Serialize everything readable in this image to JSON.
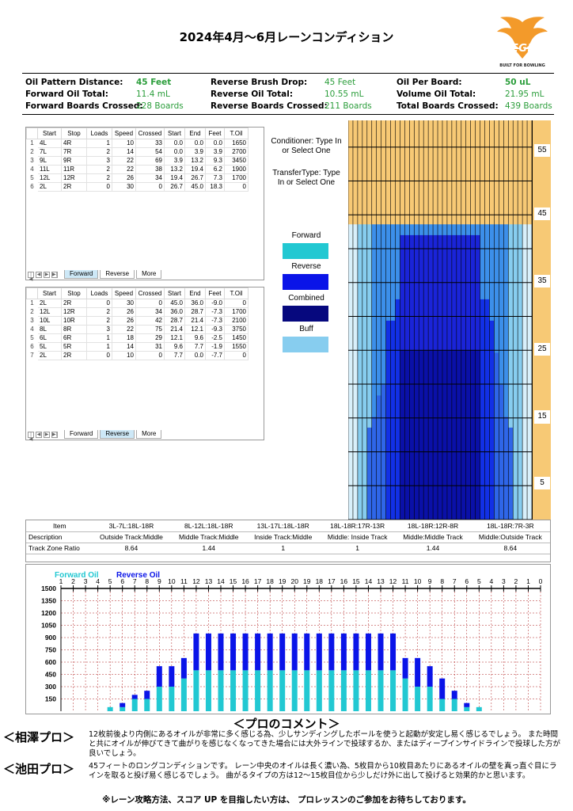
{
  "title": "2024年4月～6月レーンコンディション",
  "logo": {
    "name": "KEGEL",
    "tagline": "BUILT FOR BOWLING",
    "color": "#f39a2a"
  },
  "info": [
    {
      "label": "Oil Pattern Distance:",
      "value": "45 Feet"
    },
    {
      "label": "Reverse Brush Drop:",
      "value": "45 Feet"
    },
    {
      "label": "Oil Per Board:",
      "value": "50 uL"
    },
    {
      "label": "Forward Oil Total:",
      "value": "11.4 mL"
    },
    {
      "label": "Reverse Oil Total:",
      "value": "10.55 mL"
    },
    {
      "label": "Volume Oil Total:",
      "value": "21.95 mL"
    },
    {
      "label": "Forward Boards Crossed:",
      "value": "228 Boards"
    },
    {
      "label": "Reverse Boards Crossed:",
      "value": "211 Boards"
    },
    {
      "label": "Total Boards Crossed:",
      "value": "439 Boards"
    }
  ],
  "table_headers": [
    "Start",
    "Stop",
    "Loads",
    "Speed",
    "Crossed",
    "Start",
    "End",
    "Feet",
    "T.Oil"
  ],
  "forward_rows": [
    [
      "1",
      "4L",
      "4R",
      "1",
      "10",
      "33",
      "0.0",
      "0.0",
      "0.0",
      "1650"
    ],
    [
      "2",
      "7L",
      "7R",
      "2",
      "14",
      "54",
      "0.0",
      "3.9",
      "3.9",
      "2700"
    ],
    [
      "3",
      "9L",
      "9R",
      "3",
      "22",
      "69",
      "3.9",
      "13.2",
      "9.3",
      "3450"
    ],
    [
      "4",
      "11L",
      "11R",
      "2",
      "22",
      "38",
      "13.2",
      "19.4",
      "6.2",
      "1900"
    ],
    [
      "5",
      "12L",
      "12R",
      "2",
      "26",
      "34",
      "19.4",
      "26.7",
      "7.3",
      "1700"
    ],
    [
      "6",
      "2L",
      "2R",
      "0",
      "30",
      "0",
      "26.7",
      "45.0",
      "18.3",
      "0"
    ]
  ],
  "reverse_rows": [
    [
      "1",
      "2L",
      "2R",
      "0",
      "30",
      "0",
      "45.0",
      "36.0",
      "-9.0",
      "0"
    ],
    [
      "2",
      "12L",
      "12R",
      "2",
      "26",
      "34",
      "36.0",
      "28.7",
      "-7.3",
      "1700"
    ],
    [
      "3",
      "10L",
      "10R",
      "2",
      "26",
      "42",
      "28.7",
      "21.4",
      "-7.3",
      "2100"
    ],
    [
      "4",
      "8L",
      "8R",
      "3",
      "22",
      "75",
      "21.4",
      "12.1",
      "-9.3",
      "3750"
    ],
    [
      "5",
      "6L",
      "6R",
      "1",
      "18",
      "29",
      "12.1",
      "9.6",
      "-2.5",
      "1450"
    ],
    [
      "6",
      "5L",
      "5R",
      "1",
      "14",
      "31",
      "9.6",
      "7.7",
      "-1.9",
      "1550"
    ],
    [
      "7",
      "2L",
      "2R",
      "0",
      "10",
      "0",
      "7.7",
      "0.0",
      "-7.7",
      "0"
    ]
  ],
  "tabs_top": {
    "nav": [
      "|◀",
      "◀",
      "▶",
      "▶|"
    ],
    "items": [
      "Forward",
      "Reverse",
      "More"
    ],
    "active": 0
  },
  "tabs_bottom": {
    "nav": [
      "|◀",
      "◀",
      "▶",
      "▶|"
    ],
    "items": [
      "Forward",
      "Reverse",
      "More"
    ],
    "active": 1
  },
  "conditioner": "Conditioner: Type In or Select One",
  "transfer": "TransferType: Type In or Select One",
  "legend": [
    {
      "label": "Forward",
      "color": "#22c8d2"
    },
    {
      "label": "Reverse",
      "color": "#0a14e8"
    },
    {
      "label": "Combined",
      "color": "#06087e"
    },
    {
      "label": "Buff",
      "color": "#87cdef"
    }
  ],
  "lane_scale": [
    "55",
    "45",
    "35",
    "25",
    "15",
    "5"
  ],
  "zone": {
    "item_label": "Item",
    "desc_label": "Description",
    "ratio_label": "Track Zone Ratio",
    "columns": [
      {
        "item": "3L-7L:18L-18R",
        "desc": "Outside Track:Middle",
        "ratio": "8.64"
      },
      {
        "item": "8L-12L:18L-18R",
        "desc": "Middle Track:Middle",
        "ratio": "1.44"
      },
      {
        "item": "13L-17L:18L-18R",
        "desc": "Inside Track:Middle",
        "ratio": "1"
      },
      {
        "item": "18L-18R:17R-13R",
        "desc": "Middle: Inside Track",
        "ratio": "1"
      },
      {
        "item": "18L-18R:12R-8R",
        "desc": "Middle:Middle Track",
        "ratio": "1.44"
      },
      {
        "item": "18L-18R:7R-3R",
        "desc": "Middle:Outside Track",
        "ratio": "8.64"
      }
    ]
  },
  "chart_data": {
    "type": "bar",
    "categories": [
      "1",
      "2",
      "3",
      "4",
      "5",
      "6",
      "7",
      "8",
      "9",
      "10",
      "11",
      "12",
      "13",
      "14",
      "15",
      "16",
      "17",
      "18",
      "19",
      "20",
      "19",
      "18",
      "17",
      "16",
      "15",
      "14",
      "13",
      "12",
      "11",
      "10",
      "9",
      "8",
      "7",
      "6",
      "5",
      "4",
      "3",
      "2",
      "1",
      "0"
    ],
    "series": [
      {
        "name": "Forward Oil",
        "color": "#22c8d2",
        "values": [
          0,
          0,
          0,
          0,
          50,
          50,
          150,
          150,
          300,
          300,
          400,
          500,
          500,
          500,
          500,
          500,
          500,
          500,
          500,
          500,
          500,
          500,
          500,
          500,
          500,
          500,
          500,
          500,
          400,
          300,
          300,
          150,
          150,
          50,
          50,
          0,
          0,
          0,
          0,
          0
        ]
      },
      {
        "name": "Reverse Oil",
        "color": "#0a14e8",
        "values": [
          0,
          0,
          0,
          0,
          0,
          50,
          50,
          100,
          250,
          250,
          250,
          450,
          450,
          450,
          450,
          450,
          450,
          450,
          450,
          450,
          450,
          450,
          450,
          450,
          450,
          450,
          450,
          450,
          250,
          350,
          250,
          250,
          100,
          50,
          0,
          0,
          0,
          0,
          0,
          0
        ]
      }
    ],
    "y_ticks": [
      "1500",
      "1350",
      "1200",
      "1050",
      "900",
      "750",
      "600",
      "450",
      "300",
      "150"
    ],
    "ylim": [
      0,
      1500
    ],
    "stacked": true,
    "grid": true
  },
  "lane_profile": {
    "board_oil": [
      0,
      0,
      0,
      0,
      50,
      100,
      200,
      250,
      550,
      550,
      650,
      950,
      950,
      950,
      950,
      950,
      950,
      950,
      950,
      950,
      950,
      950,
      950,
      950,
      950,
      950,
      950,
      950,
      650,
      650,
      550,
      400,
      250,
      100,
      50,
      0,
      0,
      0,
      0,
      0
    ]
  },
  "comment_title": "＜プロのコメント＞",
  "comments": [
    {
      "name": "＜相澤プロ＞",
      "text": "12枚前後より内側にあるオイルが非常に多く感じる為、少しサンディングしたボールを使うと起動が安定し易く感じるでしょう。 また時間と共にオイルが伸びてきて曲がりを感じなくなってきた場合には大外ラインで投球するか、またはディープインサイドラインで投球した方が良いでしょう。"
    },
    {
      "name": "＜池田プロ＞",
      "text": "45フィートのロングコンディションです。 レーン中央のオイルは長く濃い為、5枚目から10枚目あたりにあるオイルの壁を真っ直ぐ目にラインを取ると投げ易く感じるでしょう。 曲がるタイプの方は12～15枚目位から少しだけ外に出して投げると効果的かと思います。"
    }
  ],
  "footer": "※レーン攻略方法、スコア UP を目指したい方は、 プロレッスンのご参加をお待ちしております。"
}
